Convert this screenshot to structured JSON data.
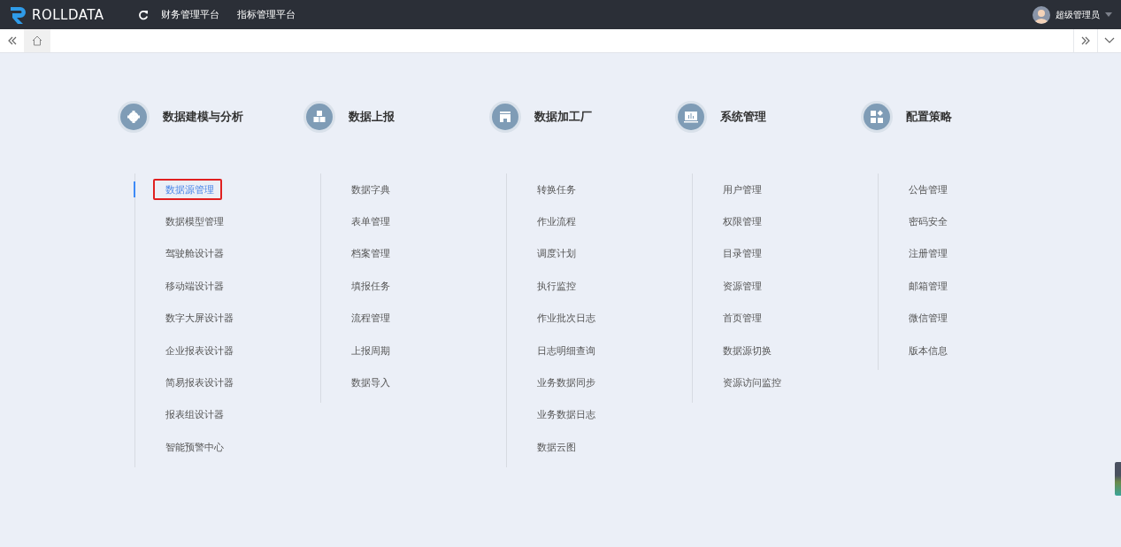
{
  "topbar": {
    "logo_text": "ROLLDATA",
    "nav": [
      "财务管理平台",
      "指标管理平台"
    ],
    "user": "超级管理员"
  },
  "groups": [
    {
      "title": "数据建模与分析",
      "kind": "gear",
      "items": [
        {
          "label": "数据源管理",
          "selected": true
        },
        {
          "label": "数据模型管理",
          "selected": false
        },
        {
          "label": "驾驶舱设计器",
          "selected": false
        },
        {
          "label": "移动端设计器",
          "selected": false
        },
        {
          "label": "数字大屏设计器",
          "selected": false
        },
        {
          "label": "企业报表设计器",
          "selected": false
        },
        {
          "label": "简易报表设计器",
          "selected": false
        },
        {
          "label": "报表组设计器",
          "selected": false
        },
        {
          "label": "智能预警中心",
          "selected": false
        }
      ]
    },
    {
      "title": "数据上报",
      "kind": "cubes",
      "items": [
        {
          "label": "数据字典",
          "selected": false
        },
        {
          "label": "表单管理",
          "selected": false
        },
        {
          "label": "档案管理",
          "selected": false
        },
        {
          "label": "填报任务",
          "selected": false
        },
        {
          "label": "流程管理",
          "selected": false
        },
        {
          "label": "上报周期",
          "selected": false
        },
        {
          "label": "数据导入",
          "selected": false
        }
      ]
    },
    {
      "title": "数据加工厂",
      "kind": "factory",
      "items": [
        {
          "label": "转换任务",
          "selected": false
        },
        {
          "label": "作业流程",
          "selected": false
        },
        {
          "label": "调度计划",
          "selected": false
        },
        {
          "label": "执行监控",
          "selected": false
        },
        {
          "label": "作业批次日志",
          "selected": false
        },
        {
          "label": "日志明细查询",
          "selected": false
        },
        {
          "label": "业务数据同步",
          "selected": false
        },
        {
          "label": "业务数据日志",
          "selected": false
        },
        {
          "label": "数据云图",
          "selected": false
        }
      ]
    },
    {
      "title": "系统管理",
      "kind": "monitor",
      "items": [
        {
          "label": "用户管理",
          "selected": false
        },
        {
          "label": "权限管理",
          "selected": false
        },
        {
          "label": "目录管理",
          "selected": false
        },
        {
          "label": "资源管理",
          "selected": false
        },
        {
          "label": "首页管理",
          "selected": false
        },
        {
          "label": "数据源切换",
          "selected": false
        },
        {
          "label": "资源访问监控",
          "selected": false
        }
      ]
    },
    {
      "title": "配置策略",
      "kind": "grid",
      "items": [
        {
          "label": "公告管理",
          "selected": false
        },
        {
          "label": "密码安全",
          "selected": false
        },
        {
          "label": "注册管理",
          "selected": false
        },
        {
          "label": "邮箱管理",
          "selected": false
        },
        {
          "label": "微信管理",
          "selected": false
        },
        {
          "label": "版本信息",
          "selected": false
        }
      ]
    }
  ]
}
